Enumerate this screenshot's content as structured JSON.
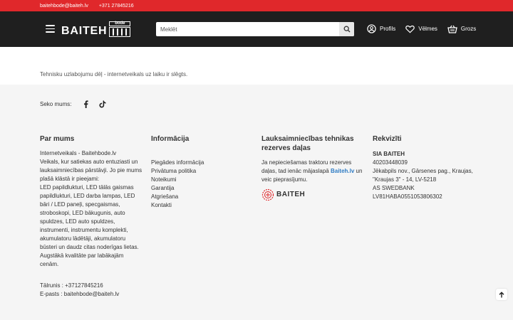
{
  "topbar": {
    "email": "baitehbode@baiteh.lv",
    "phone": "+371 27845216"
  },
  "header": {
    "logo_text": "BAITEH",
    "logo_badge": "bode",
    "search_placeholder": "Meklēt",
    "actions": [
      {
        "label": "Profils",
        "icon": "user-icon"
      },
      {
        "label": "Vēlmes",
        "icon": "heart-icon"
      },
      {
        "label": "Grozs",
        "icon": "cart-icon"
      }
    ]
  },
  "main": {
    "notice": "Tehnisku uzlabojumu dēļ - internetveikals uz laiku ir slēgts."
  },
  "footer": {
    "follow_label": "Seko mums:",
    "social": [
      "facebook-icon",
      "tiktok-icon"
    ],
    "col1": {
      "title": "Par mums",
      "about": "Internetveikals - Baitehbode.lv\nVeikals, kur satiekas auto entuziasti un lauksaimniecības pārstāvji. Jo pie mums plašā klāstā ir pieejami:\nLED papildlukturi, LED tālās gaismas papildlukturi, LED darba lampas, LED bāri / LED paneļi, specgaismas, stroboskopi, LED bākugunis, auto spuldzes, LED auto spuldzes, instrumenti, instrumentu komplekti, akumulatoru lādētāji, akumulatoru būsteri un daudz citas noderīgas lietas. Augstākā kvalitāte par labākajām cenām.",
      "phone": "Tālrunis : +37127845216",
      "email": "E-pasts : baitehbode@baiteh.lv"
    },
    "col2": {
      "title": "Informācija",
      "links": [
        "Piegādes informācija",
        "Privātuma politika",
        "Noteikumi",
        "Garantija",
        "Atgriešana",
        "Kontakti"
      ]
    },
    "col3": {
      "title": "Lauksaimniecības tehnikas rezerves daļas",
      "text_before": "Ja nepieciešamas traktoru rezerves daļas, tad ienāc mājaslapā",
      "link": "Baiteh.lv",
      "text_after": "un veic pieprasījumu.",
      "logo_text": "BAITEH"
    },
    "col4": {
      "title": "Rekvizīti",
      "company": "SIA BAITEH",
      "reg": "40203448039",
      "address1": "Jēkabpils nov., Gārsenes pag., Kraujas,",
      "address2": "\"Kraujas 3\" - 14, LV-5218",
      "bank": "AS SWEDBANK",
      "iban": "LV81HABA0551053806302"
    }
  },
  "colors": {
    "topbar": "#e0282b",
    "header": "#1f1f1f",
    "link": "#2f7cc4"
  }
}
